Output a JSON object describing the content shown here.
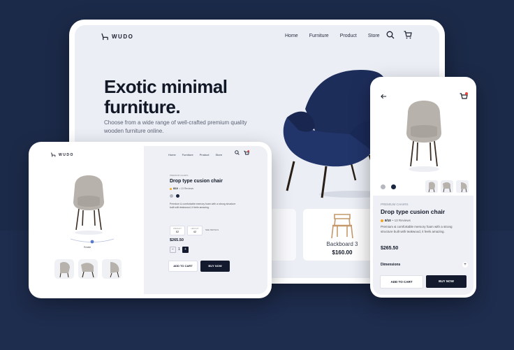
{
  "brand": {
    "logo_text": "WUDO"
  },
  "main_tablet": {
    "nav": [
      "Home",
      "Furniture",
      "Product",
      "Store"
    ],
    "hero_title_line1": "Exotic minimal",
    "hero_title_line2": "furniture.",
    "hero_subtitle": "Choose from a wide range of well-crafted premium quality wooden furniture online.",
    "card": {
      "name": "Backboard 3",
      "price": "$160.00"
    }
  },
  "product_tablet": {
    "nav": [
      "Home",
      "Furniture",
      "Product",
      "Store"
    ],
    "cart_count": "1",
    "category": "PREMIUM CHAIRS",
    "title": "Drop type cusion chair",
    "rating": "8/10",
    "reviews": "• 13 Reviews",
    "description": "Premium & comfortable memory foam with a strong structure built with teakwood, it feels amazing.",
    "specs": [
      {
        "label": "WEIGHT",
        "value": "52"
      },
      {
        "label": "HEIGHT",
        "value": "42"
      }
    ],
    "specs_more": "SEE DETAILS",
    "rotate_label": "Rotate",
    "price": "$265.50",
    "quantity": "1",
    "qty_minus": "−",
    "qty_plus": "+",
    "add_to_cart": "ADD TO CART",
    "buy_now": "BUY NOW"
  },
  "phone": {
    "cart_count": "1",
    "category": "PREMIUM CHAIRS",
    "title": "Drop type cusion chair",
    "rating": "8/10",
    "reviews": "• 13 Reviews",
    "description": "Premium & comfortable memory foam with a strong structure built with teakwood, it feels amazing.",
    "price": "$265.50",
    "dimensions_label": "Dimensions",
    "dimensions_toggle": "+",
    "add_to_cart": "ADD TO CART",
    "buy_now": "BUY NOW"
  },
  "colors": {
    "background": "#1c2a49",
    "accent_dark": "#141a2e",
    "chair_navy": "#1d2d5a",
    "chair_grey": "#b8b2ac",
    "rating_star": "#f5a623",
    "cart_badge": "#e3463d"
  },
  "icons": [
    "logo-chair-icon",
    "search-icon",
    "cart-icon",
    "back-arrow-icon",
    "star-icon"
  ]
}
